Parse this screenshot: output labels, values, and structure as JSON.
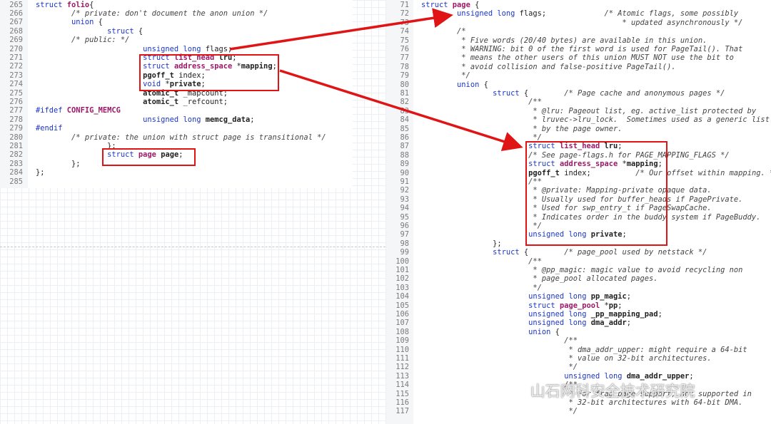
{
  "left_code": {
    "lines": [
      {
        "n": "265",
        "tokens": [
          [
            "kw",
            "struct "
          ],
          [
            "ty",
            "folio"
          ],
          [
            "",
            "{"
          ]
        ]
      },
      {
        "n": "266",
        "tokens": [
          [
            "",
            "        "
          ],
          [
            "cm",
            "/* private: don't document the anon union */"
          ]
        ]
      },
      {
        "n": "267",
        "tokens": [
          [
            "",
            "        "
          ],
          [
            "kw",
            "union"
          ],
          [
            "",
            " {"
          ]
        ]
      },
      {
        "n": "268",
        "tokens": [
          [
            "",
            "                "
          ],
          [
            "kw",
            "struct"
          ],
          [
            "",
            " {"
          ]
        ]
      },
      {
        "n": "269",
        "tokens": [
          [
            "",
            "        "
          ],
          [
            "cm",
            "/* public: */"
          ]
        ]
      },
      {
        "n": "270",
        "tokens": [
          [
            "",
            "                        "
          ],
          [
            "kw",
            "unsigned long"
          ],
          [
            "",
            " flags;"
          ]
        ]
      },
      {
        "n": "271",
        "tokens": [
          [
            "",
            "                        "
          ],
          [
            "kw",
            "struct "
          ],
          [
            "ty",
            "list_head"
          ],
          [
            "",
            " "
          ],
          [
            "b",
            "lru"
          ],
          [
            "",
            ";"
          ]
        ]
      },
      {
        "n": "272",
        "tokens": [
          [
            "",
            "                        "
          ],
          [
            "kw",
            "struct "
          ],
          [
            "ty",
            "address_space"
          ],
          [
            "",
            " *"
          ],
          [
            "b",
            "mapping"
          ],
          [
            "",
            ";"
          ]
        ]
      },
      {
        "n": "273",
        "tokens": [
          [
            "",
            "                        "
          ],
          [
            "b",
            "pgoff_t"
          ],
          [
            "",
            " index;"
          ]
        ]
      },
      {
        "n": "274",
        "tokens": [
          [
            "",
            "                        "
          ],
          [
            "kw",
            "void"
          ],
          [
            "",
            " *"
          ],
          [
            "b",
            "private"
          ],
          [
            "",
            ";"
          ]
        ]
      },
      {
        "n": "275",
        "tokens": [
          [
            "",
            "                        "
          ],
          [
            "b",
            "atomic_t"
          ],
          [
            "",
            " _mapcount;"
          ]
        ]
      },
      {
        "n": "276",
        "tokens": [
          [
            "",
            "                        "
          ],
          [
            "b",
            "atomic_t"
          ],
          [
            "",
            " _refcount;"
          ]
        ]
      },
      {
        "n": "277",
        "tokens": [
          [
            "pp",
            "#ifdef "
          ],
          [
            "ty",
            "CONFIG_MEMCG"
          ]
        ]
      },
      {
        "n": "278",
        "tokens": [
          [
            "",
            "                        "
          ],
          [
            "kw",
            "unsigned long"
          ],
          [
            "",
            " "
          ],
          [
            "b",
            "memcg_data"
          ],
          [
            "",
            ";"
          ]
        ]
      },
      {
        "n": "279",
        "tokens": [
          [
            "pp",
            "#endif"
          ]
        ]
      },
      {
        "n": "280",
        "tokens": [
          [
            "",
            "        "
          ],
          [
            "cm",
            "/* private: the union with struct page is transitional */"
          ]
        ]
      },
      {
        "n": "281",
        "tokens": [
          [
            "",
            "                "
          ],
          [
            "",
            "};"
          ]
        ]
      },
      {
        "n": "282",
        "tokens": [
          [
            "",
            "                "
          ],
          [
            "kw",
            "struct "
          ],
          [
            "ty",
            "page"
          ],
          [
            "",
            " "
          ],
          [
            "b",
            "page"
          ],
          [
            "",
            ";"
          ]
        ]
      },
      {
        "n": "283",
        "tokens": [
          [
            "",
            "        "
          ],
          [
            "",
            "};"
          ]
        ]
      },
      {
        "n": "284",
        "tokens": [
          [
            "",
            "};"
          ]
        ]
      },
      {
        "n": "285",
        "tokens": []
      }
    ]
  },
  "right_code": {
    "lines": [
      {
        "n": "71",
        "tokens": [
          [
            "kw",
            "struct "
          ],
          [
            "ty",
            "page"
          ],
          [
            "",
            " {"
          ]
        ]
      },
      {
        "n": "72",
        "tokens": [
          [
            "",
            "        "
          ],
          [
            "kw",
            "unsigned long"
          ],
          [
            "",
            " flags;             "
          ],
          [
            "cm",
            "/* Atomic flags, some possibly"
          ]
        ]
      },
      {
        "n": "73",
        "tokens": [
          [
            "",
            "                                             "
          ],
          [
            "cm",
            "* updated asynchronously */"
          ]
        ]
      },
      {
        "n": "74",
        "tokens": [
          [
            "",
            "        "
          ],
          [
            "cm",
            "/*"
          ]
        ]
      },
      {
        "n": "75",
        "tokens": [
          [
            "",
            "        "
          ],
          [
            "cm",
            " * Five words (20/40 bytes) are available in this union."
          ]
        ]
      },
      {
        "n": "76",
        "tokens": [
          [
            "",
            "        "
          ],
          [
            "cm",
            " * WARNING: bit 0 of the first word is used for PageTail(). That"
          ]
        ]
      },
      {
        "n": "77",
        "tokens": [
          [
            "",
            "        "
          ],
          [
            "cm",
            " * means the other users of this union MUST NOT use the bit to"
          ]
        ]
      },
      {
        "n": "78",
        "tokens": [
          [
            "",
            "        "
          ],
          [
            "cm",
            " * avoid collision and false-positive PageTail()."
          ]
        ]
      },
      {
        "n": "79",
        "tokens": [
          [
            "",
            "        "
          ],
          [
            "cm",
            " */"
          ]
        ]
      },
      {
        "n": "80",
        "tokens": [
          [
            "",
            "        "
          ],
          [
            "kw",
            "union"
          ],
          [
            "",
            " {"
          ]
        ]
      },
      {
        "n": "81",
        "tokens": [
          [
            "",
            "                "
          ],
          [
            "kw",
            "struct"
          ],
          [
            "",
            " {        "
          ],
          [
            "cm",
            "/* Page cache and anonymous pages */"
          ]
        ]
      },
      {
        "n": "82",
        "tokens": [
          [
            "",
            "                        "
          ],
          [
            "cm",
            "/**"
          ]
        ]
      },
      {
        "n": "83",
        "tokens": [
          [
            "",
            "                        "
          ],
          [
            "cm",
            " * @lru: Pageout list, eg. active_list protected by"
          ]
        ]
      },
      {
        "n": "84",
        "tokens": [
          [
            "",
            "                        "
          ],
          [
            "cm",
            " * lruvec->lru_lock.  Sometimes used as a generic list"
          ]
        ]
      },
      {
        "n": "85",
        "tokens": [
          [
            "",
            "                        "
          ],
          [
            "cm",
            " * by the page owner."
          ]
        ]
      },
      {
        "n": "86",
        "tokens": [
          [
            "",
            "                        "
          ],
          [
            "cm",
            " */"
          ]
        ]
      },
      {
        "n": "87",
        "tokens": [
          [
            "",
            "                        "
          ],
          [
            "kw",
            "struct "
          ],
          [
            "ty",
            "list_head"
          ],
          [
            "",
            " "
          ],
          [
            "b",
            "lru"
          ],
          [
            "",
            ";"
          ]
        ]
      },
      {
        "n": "88",
        "tokens": [
          [
            "",
            "                        "
          ],
          [
            "cm",
            "/* See page-flags.h for PAGE_MAPPING_FLAGS */"
          ]
        ]
      },
      {
        "n": "89",
        "tokens": [
          [
            "",
            "                        "
          ],
          [
            "kw",
            "struct "
          ],
          [
            "ty",
            "address_space"
          ],
          [
            "",
            " *"
          ],
          [
            "b",
            "mapping"
          ],
          [
            "",
            ";"
          ]
        ]
      },
      {
        "n": "90",
        "tokens": [
          [
            "",
            "                        "
          ],
          [
            "b",
            "pgoff_t"
          ],
          [
            "",
            " index;          "
          ],
          [
            "cm",
            "/* Our offset within mapping. */"
          ]
        ]
      },
      {
        "n": "91",
        "tokens": [
          [
            "",
            "                        "
          ],
          [
            "cm",
            "/**"
          ]
        ]
      },
      {
        "n": "92",
        "tokens": [
          [
            "",
            "                        "
          ],
          [
            "cm",
            " * @private: Mapping-private opaque data."
          ]
        ]
      },
      {
        "n": "93",
        "tokens": [
          [
            "",
            "                        "
          ],
          [
            "cm",
            " * Usually used for buffer_heads if PagePrivate."
          ]
        ]
      },
      {
        "n": "94",
        "tokens": [
          [
            "",
            "                        "
          ],
          [
            "cm",
            " * Used for swp_entry_t if PageSwapCache."
          ]
        ]
      },
      {
        "n": "95",
        "tokens": [
          [
            "",
            "                        "
          ],
          [
            "cm",
            " * Indicates order in the buddy system if PageBuddy."
          ]
        ]
      },
      {
        "n": "96",
        "tokens": [
          [
            "",
            "                        "
          ],
          [
            "cm",
            " */"
          ]
        ]
      },
      {
        "n": "97",
        "tokens": [
          [
            "",
            "                        "
          ],
          [
            "kw",
            "unsigned long"
          ],
          [
            "",
            " "
          ],
          [
            "b",
            "private"
          ],
          [
            "",
            ";"
          ]
        ]
      },
      {
        "n": "98",
        "tokens": [
          [
            "",
            "                "
          ],
          [
            "",
            "};"
          ]
        ]
      },
      {
        "n": "99",
        "tokens": [
          [
            "",
            "                "
          ],
          [
            "kw",
            "struct"
          ],
          [
            "",
            " {        "
          ],
          [
            "cm",
            "/* page_pool used by netstack */"
          ]
        ]
      },
      {
        "n": "100",
        "tokens": [
          [
            "",
            "                        "
          ],
          [
            "cm",
            "/**"
          ]
        ]
      },
      {
        "n": "101",
        "tokens": [
          [
            "",
            "                        "
          ],
          [
            "cm",
            " * @pp_magic: magic value to avoid recycling non"
          ]
        ]
      },
      {
        "n": "102",
        "tokens": [
          [
            "",
            "                        "
          ],
          [
            "cm",
            " * page_pool allocated pages."
          ]
        ]
      },
      {
        "n": "103",
        "tokens": [
          [
            "",
            "                        "
          ],
          [
            "cm",
            " */"
          ]
        ]
      },
      {
        "n": "104",
        "tokens": [
          [
            "",
            "                        "
          ],
          [
            "kw",
            "unsigned long"
          ],
          [
            "",
            " "
          ],
          [
            "b",
            "pp_magic"
          ],
          [
            "",
            ";"
          ]
        ]
      },
      {
        "n": "105",
        "tokens": [
          [
            "",
            "                        "
          ],
          [
            "kw",
            "struct "
          ],
          [
            "ty",
            "page_pool"
          ],
          [
            "",
            " *"
          ],
          [
            "b",
            "pp"
          ],
          [
            "",
            ";"
          ]
        ]
      },
      {
        "n": "106",
        "tokens": [
          [
            "",
            "                        "
          ],
          [
            "kw",
            "unsigned long"
          ],
          [
            "",
            " "
          ],
          [
            "b",
            "_pp_mapping_pad"
          ],
          [
            "",
            ";"
          ]
        ]
      },
      {
        "n": "107",
        "tokens": [
          [
            "",
            "                        "
          ],
          [
            "kw",
            "unsigned long"
          ],
          [
            "",
            " "
          ],
          [
            "b",
            "dma_addr"
          ],
          [
            "",
            ";"
          ]
        ]
      },
      {
        "n": "108",
        "tokens": [
          [
            "",
            "                        "
          ],
          [
            "kw",
            "union"
          ],
          [
            "",
            " {"
          ]
        ]
      },
      {
        "n": "109",
        "tokens": [
          [
            "",
            "                                "
          ],
          [
            "cm",
            "/**"
          ]
        ]
      },
      {
        "n": "110",
        "tokens": [
          [
            "",
            "                                "
          ],
          [
            "cm",
            " * dma_addr_upper: might require a 64-bit"
          ]
        ]
      },
      {
        "n": "111",
        "tokens": [
          [
            "",
            "                                "
          ],
          [
            "cm",
            " * value on 32-bit architectures."
          ]
        ]
      },
      {
        "n": "112",
        "tokens": [
          [
            "",
            "                                "
          ],
          [
            "cm",
            " */"
          ]
        ]
      },
      {
        "n": "113",
        "tokens": [
          [
            "",
            "                                "
          ],
          [
            "kw",
            "unsigned long"
          ],
          [
            "",
            " "
          ],
          [
            "b",
            "dma_addr_upper"
          ],
          [
            "",
            ";"
          ]
        ]
      },
      {
        "n": "114",
        "tokens": [
          [
            "",
            "                                "
          ],
          [
            "cm",
            "/**"
          ]
        ]
      },
      {
        "n": "115",
        "tokens": [
          [
            "",
            "                                "
          ],
          [
            "cm",
            " * For frag page support, not supported in"
          ]
        ]
      },
      {
        "n": "116",
        "tokens": [
          [
            "",
            "                                "
          ],
          [
            "cm",
            " * 32-bit architectures with 64-bit DMA."
          ]
        ]
      },
      {
        "n": "117",
        "tokens": [
          [
            "",
            "                                "
          ],
          [
            "cm",
            " */"
          ]
        ]
      }
    ]
  },
  "watermark": {
    "text": "山石网科安全技术研究院",
    "icon": "wechat-icon"
  },
  "colors": {
    "highlight": "#e01414",
    "keyword": "#1b35c8",
    "type": "#9a1a68"
  }
}
